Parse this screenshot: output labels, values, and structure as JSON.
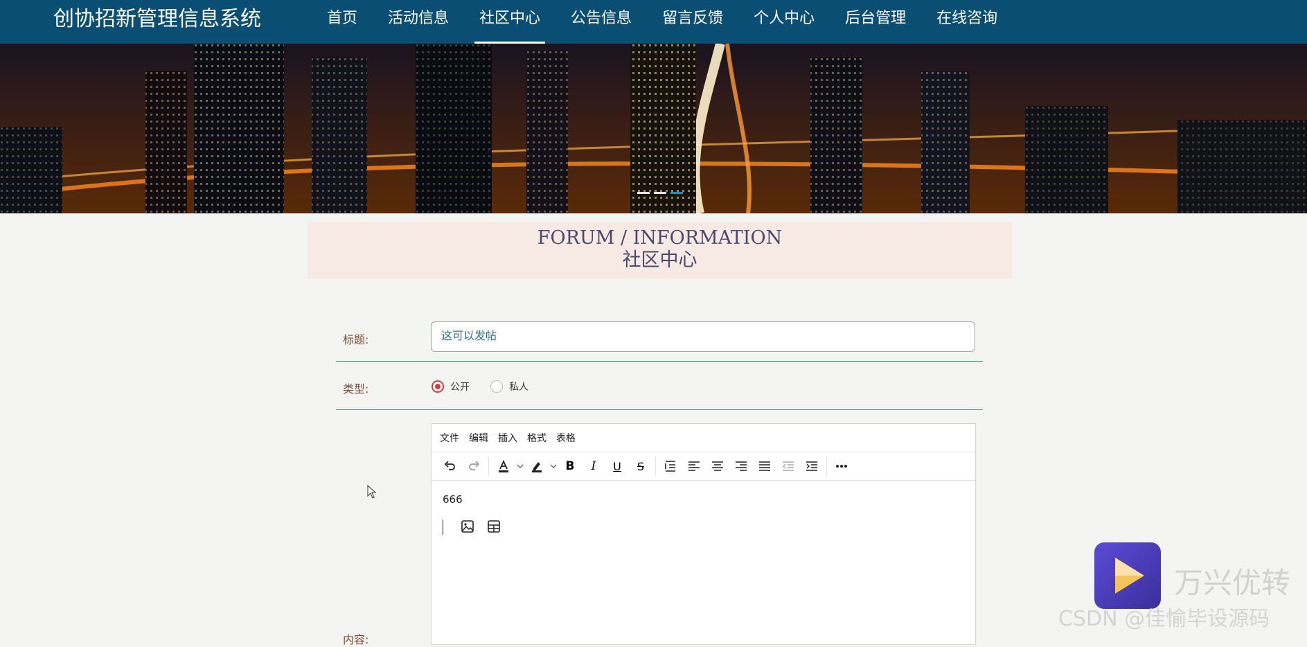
{
  "header": {
    "brand": "创协招新管理信息系统",
    "nav": [
      {
        "label": "首页"
      },
      {
        "label": "活动信息"
      },
      {
        "label": "社区中心",
        "active": true
      },
      {
        "label": "公告信息"
      },
      {
        "label": "留言反馈"
      },
      {
        "label": "个人中心"
      },
      {
        "label": "后台管理"
      },
      {
        "label": "在线咨询"
      }
    ],
    "color": "#0a4f73"
  },
  "section_title": {
    "en": "FORUM / INFORMATION",
    "zh": "社区中心"
  },
  "form": {
    "title_label": "标题:",
    "title_value": "这可以发帖",
    "type_label": "类型:",
    "type_options": [
      {
        "label": "公开",
        "checked": true
      },
      {
        "label": "私人",
        "checked": false
      }
    ],
    "content_label": "内容:"
  },
  "editor": {
    "menu": [
      "文件",
      "编辑",
      "插入",
      "格式",
      "表格"
    ],
    "toolbar_icons": [
      "undo-icon",
      "redo-icon",
      "text-color-icon",
      "highlight-icon",
      "bold-icon",
      "italic-icon",
      "underline-icon",
      "strikethrough-icon",
      "line-height-icon",
      "align-left-icon",
      "align-center-icon",
      "align-right-icon",
      "align-justify-icon",
      "outdent-icon",
      "indent-icon",
      "more-icon"
    ],
    "content_text": "666",
    "quick_icons": [
      "image-icon",
      "table-icon"
    ]
  },
  "watermark": {
    "app": "万兴优转",
    "source": "CSDN @佳愉毕设源码"
  },
  "banner_dots": 3
}
